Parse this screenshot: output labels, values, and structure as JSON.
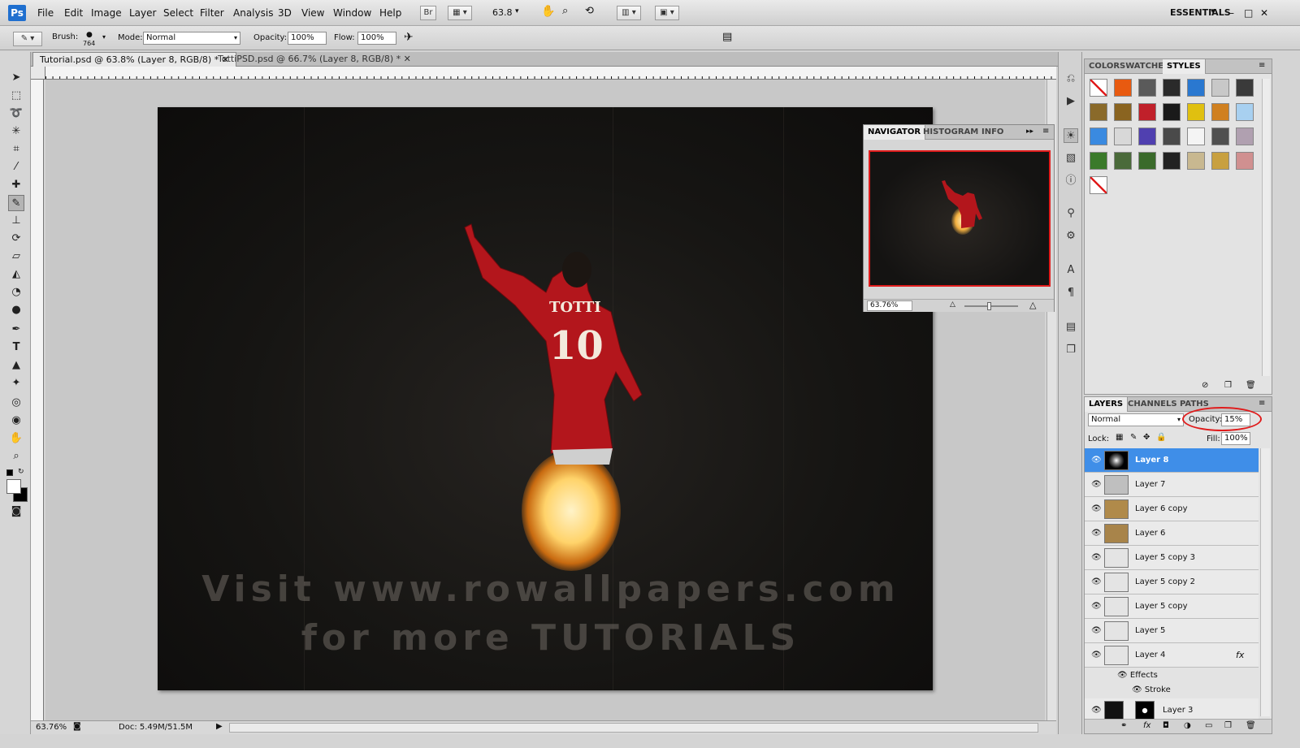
{
  "menubar": {
    "logo": "Ps",
    "items": [
      "File",
      "Edit",
      "Image",
      "Layer",
      "Select",
      "Filter",
      "Analysis",
      "3D",
      "View",
      "Window",
      "Help"
    ],
    "bridge_label": "Br",
    "zoom_value": "63.8",
    "workspace": "ESSENTIALS",
    "window_controls": [
      "–",
      "□",
      "✕"
    ]
  },
  "options": {
    "brush_label": "Brush:",
    "brush_size": "764",
    "mode_label": "Mode:",
    "mode_value": "Normal",
    "opacity_label": "Opacity:",
    "opacity_value": "100%",
    "flow_label": "Flow:",
    "flow_value": "100%"
  },
  "tabs": [
    "Tutorial.psd @ 63.8% (Layer 8, RGB/8) *",
    "TottiPSD.psd @ 66.7% (Layer 8, RGB/8) *"
  ],
  "artwork": {
    "jersey_name": "TOTTI",
    "jersey_number": "10",
    "watermark_line1": "Visit www.rowallpapers.com",
    "watermark_line2": "for more TUTORIALS"
  },
  "statusbar": {
    "zoom": "63.76%",
    "doc": "Doc: 5.49M/51.5M"
  },
  "navigator": {
    "tabs": [
      "NAVIGATOR",
      "HISTOGRAM",
      "INFO"
    ],
    "zoom": "63.76%"
  },
  "styles_panel": {
    "tabs": [
      "COLOR",
      "SWATCHES",
      "STYLES"
    ]
  },
  "layers_panel": {
    "tabs": [
      "LAYERS",
      "CHANNELS",
      "PATHS"
    ],
    "blend_mode": "Normal",
    "opacity_label": "Opacity:",
    "opacity_value": "15%",
    "lock_label": "Lock:",
    "fill_label": "Fill:",
    "fill_value": "100%",
    "layers": [
      {
        "name": "Layer 8",
        "selected": true
      },
      {
        "name": "Layer 7",
        "selected": false
      },
      {
        "name": "Layer 6 copy",
        "selected": false
      },
      {
        "name": "Layer 6",
        "selected": false
      },
      {
        "name": "Layer 5 copy 3",
        "selected": false
      },
      {
        "name": "Layer 5 copy 2",
        "selected": false
      },
      {
        "name": "Layer 5 copy",
        "selected": false
      },
      {
        "name": "Layer 5",
        "selected": false
      },
      {
        "name": "Layer 4",
        "selected": false
      }
    ],
    "effects_label": "Effects",
    "stroke_label": "Stroke",
    "layer3_name": "Layer 3",
    "fx_label": "fx"
  },
  "colors": {
    "accent_selected": "#3f8ee8",
    "annotation_red": "#e01c1c",
    "jersey_red": "#b3161c"
  }
}
